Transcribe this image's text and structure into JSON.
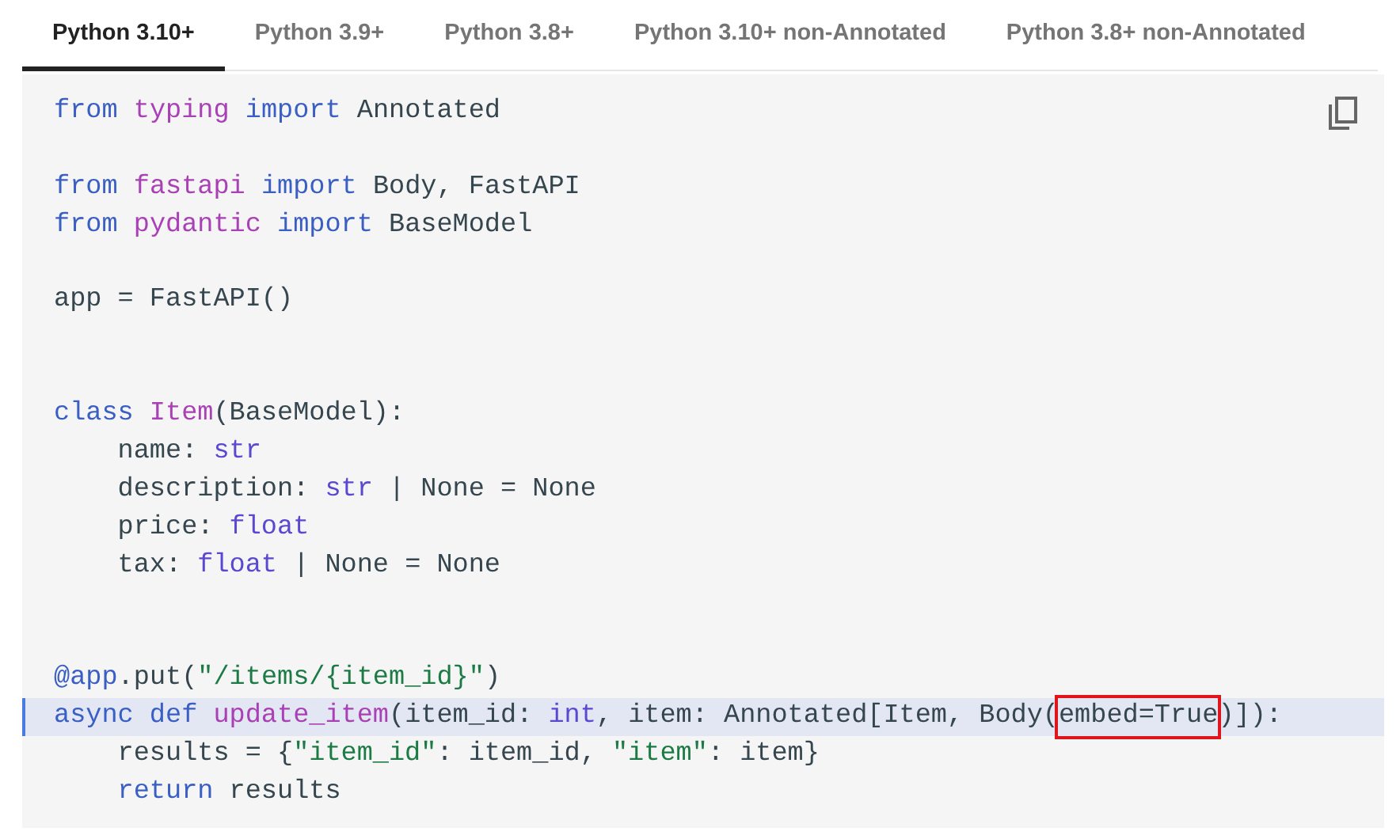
{
  "tabs": [
    {
      "label": "Python 3.10+",
      "selected": true
    },
    {
      "label": "Python 3.9+",
      "selected": false
    },
    {
      "label": "Python 3.8+",
      "selected": false
    },
    {
      "label": "Python 3.10+ non-Annotated",
      "selected": false
    },
    {
      "label": "Python 3.8+ non-Annotated",
      "selected": false
    }
  ],
  "code": {
    "lines": [
      {
        "kind": "code",
        "highlighted": false,
        "tokens": [
          {
            "text": "from",
            "kind": "keyword"
          },
          {
            "text": " typing",
            "kind": "module"
          },
          {
            "text": " import",
            "kind": "keyword"
          },
          {
            "text": " Annotated",
            "kind": "plain"
          }
        ]
      },
      {
        "kind": "blank",
        "highlighted": false
      },
      {
        "kind": "code",
        "highlighted": false,
        "tokens": [
          {
            "text": "from",
            "kind": "keyword"
          },
          {
            "text": " fastapi",
            "kind": "module"
          },
          {
            "text": " import",
            "kind": "keyword"
          },
          {
            "text": " Body, FastAPI",
            "kind": "plain"
          }
        ]
      },
      {
        "kind": "code",
        "highlighted": false,
        "tokens": [
          {
            "text": "from",
            "kind": "keyword"
          },
          {
            "text": " pydantic",
            "kind": "module"
          },
          {
            "text": " import",
            "kind": "keyword"
          },
          {
            "text": " BaseModel",
            "kind": "plain"
          }
        ]
      },
      {
        "kind": "blank",
        "highlighted": false
      },
      {
        "kind": "code",
        "highlighted": false,
        "tokens": [
          {
            "text": "app = FastAPI()",
            "kind": "plain"
          }
        ]
      },
      {
        "kind": "blank",
        "highlighted": false
      },
      {
        "kind": "blank",
        "highlighted": false
      },
      {
        "kind": "code",
        "highlighted": false,
        "tokens": [
          {
            "text": "class",
            "kind": "keyword"
          },
          {
            "text": " Item",
            "kind": "name"
          },
          {
            "text": "(BaseModel):",
            "kind": "plain"
          }
        ]
      },
      {
        "kind": "code",
        "highlighted": false,
        "tokens": [
          {
            "text": "    name: ",
            "kind": "plain"
          },
          {
            "text": "str",
            "kind": "type"
          }
        ]
      },
      {
        "kind": "code",
        "highlighted": false,
        "tokens": [
          {
            "text": "    description: ",
            "kind": "plain"
          },
          {
            "text": "str",
            "kind": "type"
          },
          {
            "text": " | None = None",
            "kind": "plain"
          }
        ]
      },
      {
        "kind": "code",
        "highlighted": false,
        "tokens": [
          {
            "text": "    price: ",
            "kind": "plain"
          },
          {
            "text": "float",
            "kind": "type"
          }
        ]
      },
      {
        "kind": "code",
        "highlighted": false,
        "tokens": [
          {
            "text": "    tax: ",
            "kind": "plain"
          },
          {
            "text": "float",
            "kind": "type"
          },
          {
            "text": " | None = None",
            "kind": "plain"
          }
        ]
      },
      {
        "kind": "blank",
        "highlighted": false
      },
      {
        "kind": "blank",
        "highlighted": false
      },
      {
        "kind": "code",
        "highlighted": false,
        "tokens": [
          {
            "text": "@app",
            "kind": "keyword"
          },
          {
            "text": ".put(",
            "kind": "plain"
          },
          {
            "text": "\"/items/{item_id}\"",
            "kind": "string"
          },
          {
            "text": ")",
            "kind": "plain"
          }
        ]
      },
      {
        "kind": "code",
        "highlighted": true,
        "tokens": [
          {
            "text": "async def",
            "kind": "keyword"
          },
          {
            "text": " update_item",
            "kind": "name"
          },
          {
            "text": "(item_id: ",
            "kind": "plain"
          },
          {
            "text": "int",
            "kind": "type"
          },
          {
            "text": ", item: Annotated[Item, Body(",
            "kind": "plain"
          },
          {
            "text": "embed=True",
            "kind": "boxed"
          },
          {
            "text": ")]):",
            "kind": "plain"
          }
        ]
      },
      {
        "kind": "code",
        "highlighted": false,
        "tokens": [
          {
            "text": "    results = {",
            "kind": "plain"
          },
          {
            "text": "\"item_id\"",
            "kind": "string"
          },
          {
            "text": ": item_id, ",
            "kind": "plain"
          },
          {
            "text": "\"item\"",
            "kind": "string"
          },
          {
            "text": ": item}",
            "kind": "plain"
          }
        ]
      },
      {
        "kind": "code",
        "highlighted": false,
        "tokens": [
          {
            "text": "    return",
            "kind": "keyword"
          },
          {
            "text": " results",
            "kind": "plain"
          }
        ]
      }
    ]
  }
}
